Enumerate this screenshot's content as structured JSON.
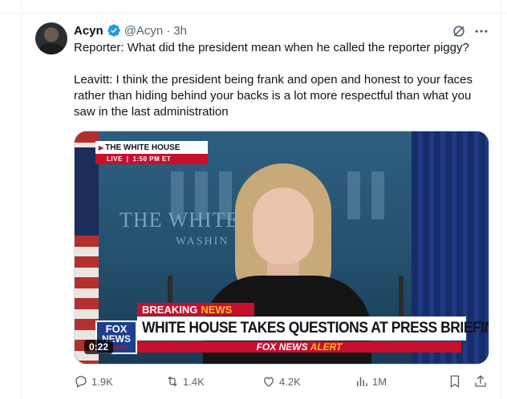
{
  "tweet": {
    "author_name": "Acyn",
    "handle": "@Acyn",
    "separator": "·",
    "time": "3h",
    "text_line1": "Reporter: What did the president mean when he called the reporter piggy?",
    "text_line2": "Leavitt: I think the president being frank and open and honest to your faces rather than hiding behind your backs is a lot more respectful than what you saw in the last administration"
  },
  "video": {
    "wh_title": "THE WHITE HOUSE",
    "live_label": "LIVE",
    "live_time": "1:50 PM ET",
    "backdrop_text": "THE WHITE",
    "backdrop_text2": "WASHIN",
    "breaking": "BREAKING",
    "breaking_news": "NEWS",
    "headline": "WHITE HOUSE TAKES QUESTIONS AT PRESS BRIEFING",
    "fox_logo_1": "FOX",
    "fox_logo_2": "NEWS",
    "fox_logo_3": "channel",
    "alert_brand": "FOX NEWS",
    "alert_word": "ALERT",
    "timestamp": "0:22"
  },
  "actions": {
    "replies": "1.9K",
    "reposts": "1.4K",
    "likes": "4.2K",
    "views": "1M"
  },
  "icons": {
    "verified": "verified-badge-icon",
    "grok": "grok-icon",
    "more": "more-icon",
    "reply": "reply-icon",
    "repost": "repost-icon",
    "like": "heart-icon",
    "views": "views-chart-icon",
    "bookmark": "bookmark-icon",
    "share": "share-icon"
  },
  "colors": {
    "verified_blue": "#1d9bf0",
    "text_secondary": "#536471",
    "fox_red": "#c8102e",
    "fox_yellow": "#f9c21b"
  }
}
